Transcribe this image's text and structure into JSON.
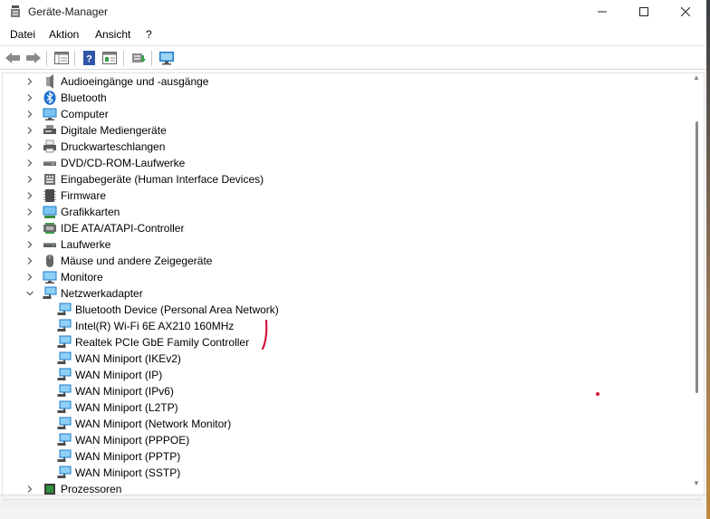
{
  "window": {
    "title": "Geräte-Manager",
    "controls": {
      "minimize": "—",
      "maximize": "☐",
      "close": "✕"
    }
  },
  "menu": {
    "items": [
      "Datei",
      "Aktion",
      "Ansicht",
      "?"
    ]
  },
  "toolbar": {
    "buttons": [
      "back-arrow-icon",
      "forward-arrow-icon",
      "properties-view-icon",
      "help-icon",
      "details-view-icon",
      "update-driver-icon",
      "monitor-scan-icon"
    ]
  },
  "tree": {
    "categories": [
      {
        "label": "Audioeingänge und -ausgänge",
        "icon": "speaker-icon",
        "expanded": false
      },
      {
        "label": "Bluetooth",
        "icon": "bluetooth-icon",
        "expanded": false
      },
      {
        "label": "Computer",
        "icon": "computer-icon",
        "expanded": false
      },
      {
        "label": "Digitale Mediengeräte",
        "icon": "media-device-icon",
        "expanded": false
      },
      {
        "label": "Druckwarteschlangen",
        "icon": "printer-icon",
        "expanded": false
      },
      {
        "label": "DVD/CD-ROM-Laufwerke",
        "icon": "dvd-drive-icon",
        "expanded": false
      },
      {
        "label": "Eingabegeräte (Human Interface Devices)",
        "icon": "hid-icon",
        "expanded": false
      },
      {
        "label": "Firmware",
        "icon": "firmware-chip-icon",
        "expanded": false
      },
      {
        "label": "Grafikkarten",
        "icon": "display-adapter-icon",
        "expanded": false
      },
      {
        "label": "IDE ATA/ATAPI-Controller",
        "icon": "ide-controller-icon",
        "expanded": false
      },
      {
        "label": "Laufwerke",
        "icon": "disk-drive-icon",
        "expanded": false
      },
      {
        "label": "Mäuse und andere Zeigegeräte",
        "icon": "mouse-icon",
        "expanded": false
      },
      {
        "label": "Monitore",
        "icon": "monitor-icon",
        "expanded": false
      },
      {
        "label": "Netzwerkadapter",
        "icon": "network-adapter-icon",
        "expanded": true
      }
    ],
    "network_adapters": [
      "Bluetooth Device (Personal Area Network)",
      "Intel(R) Wi-Fi 6E AX210 160MHz",
      "Realtek PCIe GbE Family Controller",
      "WAN Miniport (IKEv2)",
      "WAN Miniport (IP)",
      "WAN Miniport (IPv6)",
      "WAN Miniport (L2TP)",
      "WAN Miniport (Network Monitor)",
      "WAN Miniport (PPPOE)",
      "WAN Miniport (PPTP)",
      "WAN Miniport (SSTP)"
    ],
    "after": [
      {
        "label": "Prozessoren",
        "icon": "processor-icon",
        "expanded": false
      }
    ]
  },
  "colors": {
    "annotation": "#d0183a",
    "icon_blue": "#2e8bd6",
    "icon_grey": "#6b6b6b"
  }
}
